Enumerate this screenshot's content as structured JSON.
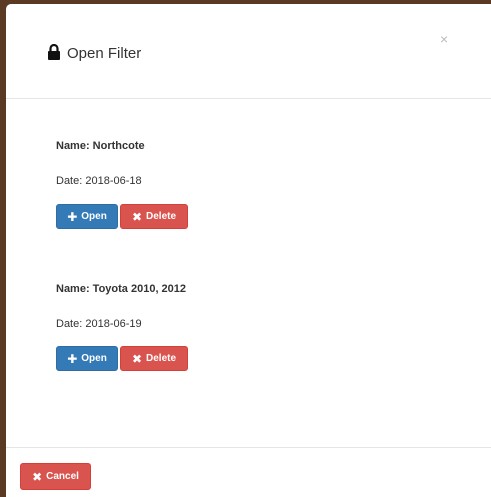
{
  "modal": {
    "title": "Open Filter",
    "title_icon": "lock-icon",
    "close_symbol": "×"
  },
  "filters": [
    {
      "name": "Name: Northcote",
      "date": "Date: 2018-06-18",
      "open_label": "Open",
      "delete_label": "Delete"
    },
    {
      "name": "Name: Toyota 2010, 2012",
      "date": "Date: 2018-06-19",
      "open_label": "Open",
      "delete_label": "Delete"
    }
  ],
  "footer": {
    "cancel_label": "Cancel"
  },
  "icons": {
    "open": "plus-icon",
    "delete": "x-icon",
    "cancel": "x-icon"
  },
  "colors": {
    "primary": "#337ab7",
    "danger": "#d9534f",
    "backdrop": "#5a3a22"
  }
}
